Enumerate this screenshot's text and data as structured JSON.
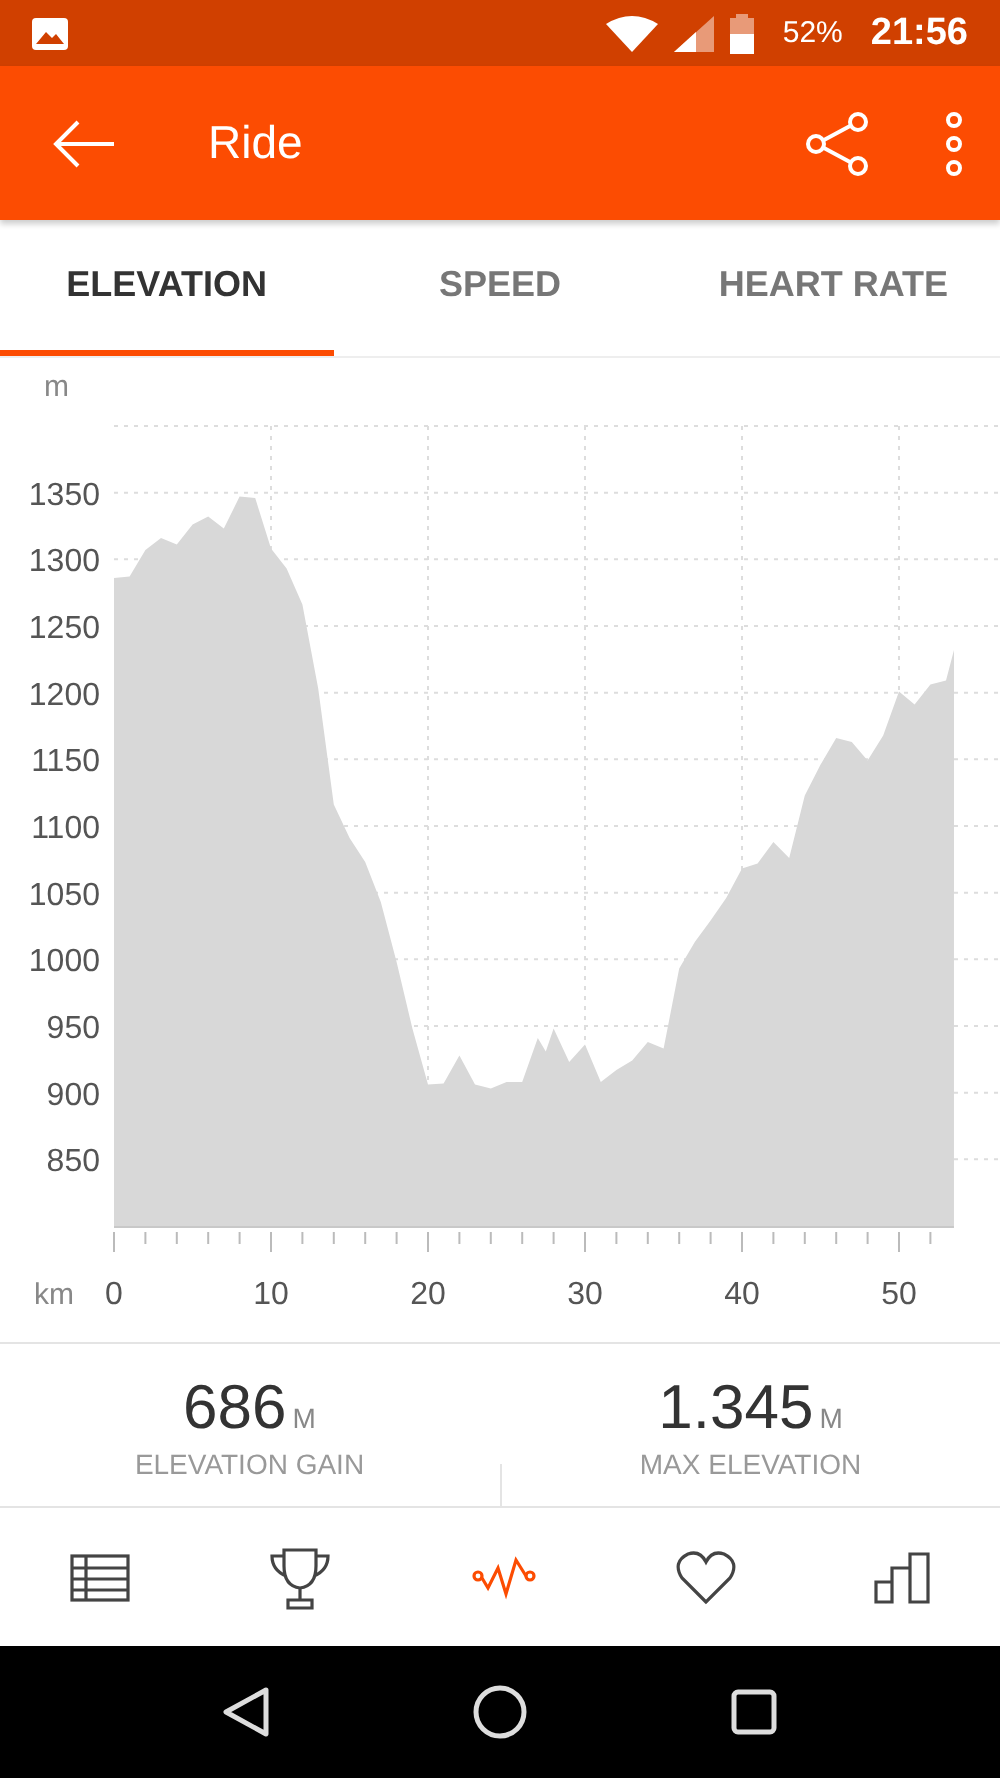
{
  "status_bar": {
    "battery": "52%",
    "time": "21:56"
  },
  "app_bar": {
    "title": "Ride"
  },
  "tabs": [
    {
      "label": "ELEVATION",
      "selected": true
    },
    {
      "label": "SPEED",
      "selected": false
    },
    {
      "label": "HEART RATE",
      "selected": false
    }
  ],
  "chart": {
    "chart_data": {
      "type": "area",
      "xlabel": "km",
      "ylabel": "m",
      "x": [
        0,
        1,
        2,
        3,
        4,
        5,
        6,
        7,
        8,
        9,
        10,
        11,
        12,
        13,
        14,
        15,
        16,
        17,
        18,
        19,
        20,
        21,
        22,
        23,
        24,
        25,
        26,
        27,
        27.5,
        28,
        29,
        30,
        31,
        32,
        33,
        34,
        35,
        36,
        37,
        38,
        39,
        40,
        41,
        42,
        43,
        44,
        45,
        46,
        47,
        48,
        49,
        50,
        51,
        52,
        53,
        53.5
      ],
      "series": [
        {
          "color": "#d8d8d8",
          "values": [
            1286,
            1287,
            1307,
            1316,
            1311,
            1326,
            1332,
            1323,
            1347,
            1346,
            1308,
            1293,
            1266,
            1203,
            1116,
            1091,
            1073,
            1043,
            998,
            948,
            906,
            907,
            928,
            906,
            903,
            908,
            908,
            941,
            931,
            948,
            923,
            936,
            908,
            917,
            924,
            938,
            933,
            993,
            1013,
            1029,
            1046,
            1068,
            1072,
            1088,
            1076,
            1123,
            1146,
            1166,
            1163,
            1149,
            1168,
            1201,
            1191,
            1206,
            1209,
            1232
          ]
        }
      ],
      "grid": true,
      "xlim": [
        0,
        53.5
      ],
      "ylim": [
        800,
        1400
      ],
      "xticks": [
        0,
        10,
        20,
        30,
        40,
        50
      ],
      "yticks": [
        850,
        900,
        950,
        1000,
        1050,
        1100,
        1150,
        1200,
        1250,
        1300,
        1350
      ]
    }
  },
  "stats": [
    {
      "value": "686",
      "unit": "M",
      "label": "ELEVATION GAIN"
    },
    {
      "value": "1.345",
      "unit": "M",
      "label": "MAX ELEVATION"
    }
  ],
  "bottom_nav": [
    {
      "kind": "table",
      "selected": false
    },
    {
      "kind": "trophy",
      "selected": false
    },
    {
      "kind": "activity",
      "selected": true
    },
    {
      "kind": "heart",
      "selected": false
    },
    {
      "kind": "bars",
      "selected": false
    }
  ]
}
